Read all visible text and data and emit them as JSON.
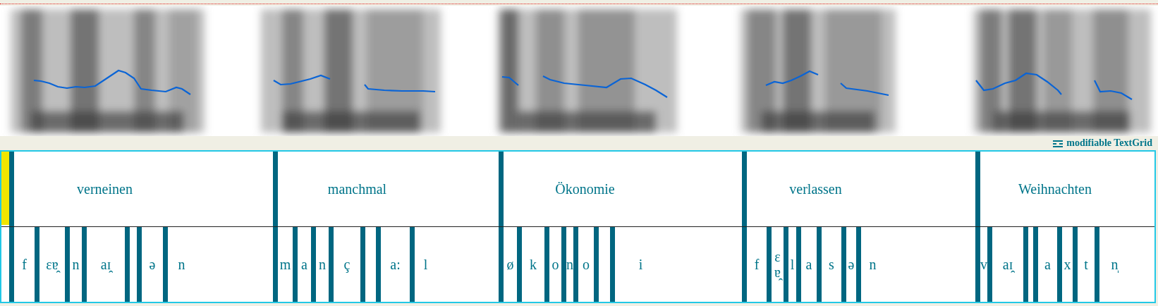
{
  "textgrid": {
    "label": "modifiable TextGrid"
  },
  "words": [
    {
      "label": "verneinen",
      "phones": [
        "f",
        "ɛɐ̯",
        "n",
        "aɪ̯",
        "ə",
        "n"
      ]
    },
    {
      "label": "manchmal",
      "phones": [
        "m",
        "a",
        "n",
        "ç",
        "a:",
        "l"
      ]
    },
    {
      "label": "Ökonomie",
      "phones": [
        "ø",
        "k",
        "o",
        "n",
        "o",
        "i"
      ]
    },
    {
      "label": "verlassen",
      "phones": [
        "f",
        "ɛɐ̯",
        "l",
        "a",
        "s",
        "ə",
        "n"
      ]
    },
    {
      "label": "Weihnachten",
      "phones": [
        "v",
        "aɪ̯",
        "a",
        "x",
        "t",
        "n̩"
      ]
    }
  ]
}
